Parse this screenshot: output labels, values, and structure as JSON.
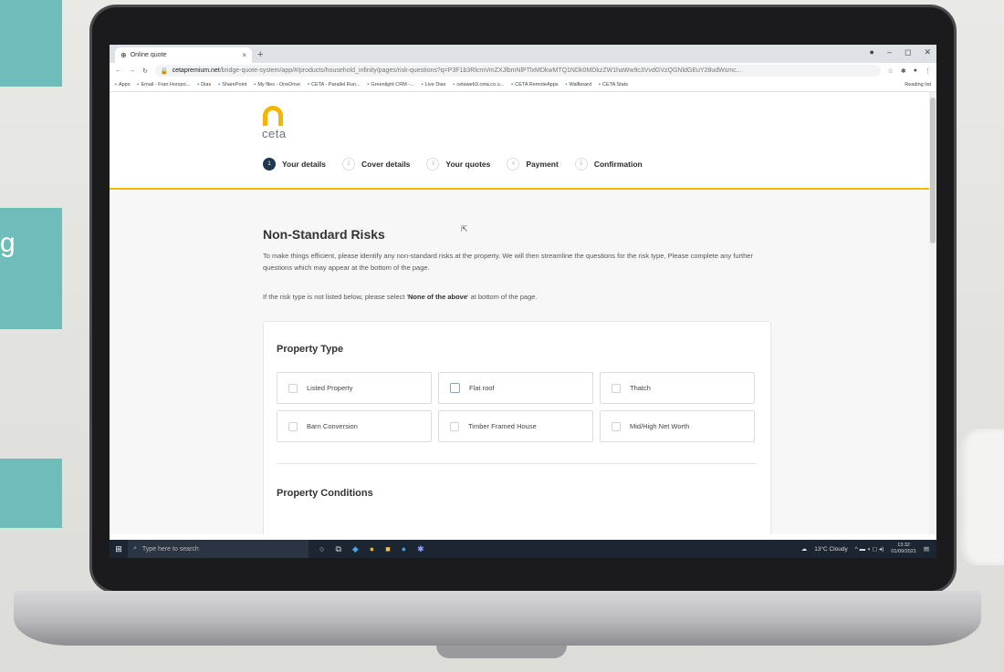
{
  "background": {
    "teal_color": "#6fbdbb",
    "teal_letter": "g"
  },
  "browser": {
    "tab_title": "Online quote",
    "tab_close": "×",
    "new_tab": "+",
    "url_host": "cetapremium.net",
    "url_path": "/bridge-quote-system/app/#/products/household_infinity/pages/risk-questions?q=P3F1b3RlcmVmZXJlbmNlPTlxMDkwMTQ1NDk0MDkzZW1haWw9c3VvdGVzQGNldGEuY28udWsmc...",
    "bookmarks": [
      "Apps",
      "Email - Fran Horspo...",
      "Dias",
      "SharePoint",
      "My files - OneDrive",
      "CETA - Parallel Run...",
      "Greenlight CRM -...",
      "Live Dias",
      "cetaweb3.ceta.co.u...",
      "CETA RemoteApps",
      "Wallboard",
      "CETA Stats"
    ],
    "reading_list": "Reading list"
  },
  "site": {
    "logo_text": "ceta",
    "steps": [
      {
        "num": "1",
        "label": "Your details"
      },
      {
        "num": "2",
        "label": "Cover details"
      },
      {
        "num": "3",
        "label": "Your quotes"
      },
      {
        "num": "4",
        "label": "Payment"
      },
      {
        "num": "5",
        "label": "Confirmation"
      }
    ]
  },
  "main": {
    "heading": "Non-Standard Risks",
    "intro": "To make things efficient, please identify any non-standard risks at the property. We will then streamline the questions for the risk type, Please complete any further questions which may appear at the bottom of the page.",
    "note_prefix": "If the risk type is not listed below, please select '",
    "note_bold": "None of the above",
    "note_suffix": "' at bottom of the page.",
    "property_type": {
      "title": "Property Type",
      "options": [
        "Listed Property",
        "Flat roof",
        "Thatch",
        "Barn Conversion",
        "Timber Framed House",
        "Mid/High Net Worth"
      ]
    },
    "property_conditions": {
      "title": "Property Conditions"
    }
  },
  "taskbar": {
    "search_placeholder": "Type here to search",
    "weather": "13°C Cloudy",
    "time": "13:32",
    "date": "01/09/2021"
  }
}
